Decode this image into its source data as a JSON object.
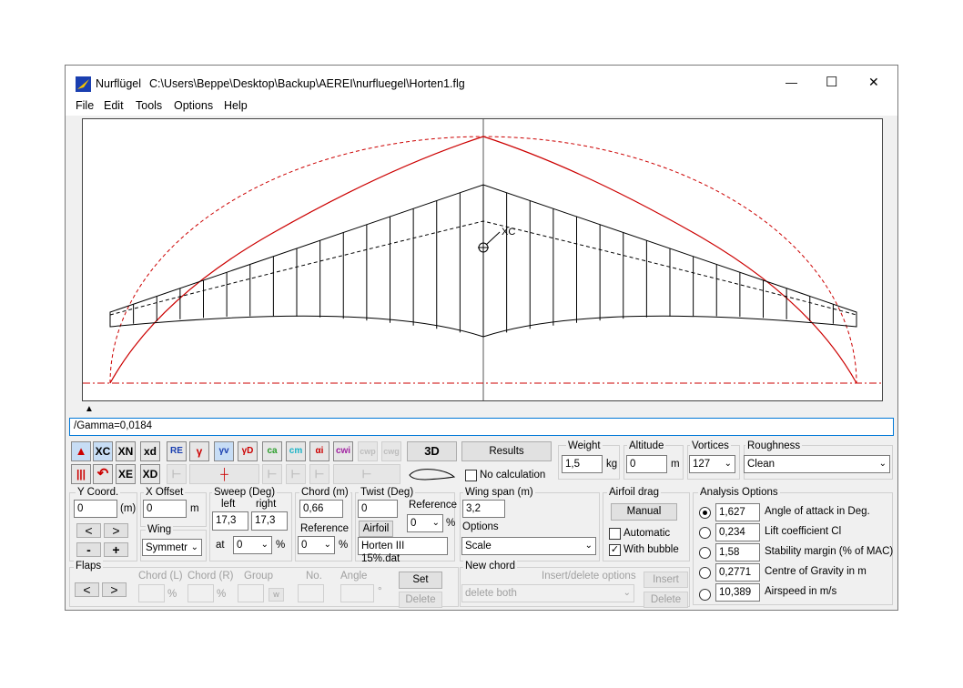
{
  "titlebar": {
    "app_name": "Nurflügel",
    "file_path": "C:\\Users\\Beppe\\Desktop\\Backup\\AEREI\\nurfluegel\\Horten1.flg",
    "minimize": "—",
    "maximize": "☐",
    "close": "✕"
  },
  "menu": [
    "File",
    "Edit",
    "Tools",
    "Options",
    "Help"
  ],
  "canvas": {
    "xc_label": "XC"
  },
  "status": "/Gamma=0,0184",
  "toolbar": {
    "row1": [
      "XC",
      "XN",
      "xd",
      "RE",
      "γ",
      "γv",
      "γD",
      "ca",
      "cm",
      "αi",
      "cwi",
      "cwp",
      "cwg"
    ],
    "row2": [
      "XE",
      "XD"
    ],
    "btn_3d": "3D"
  },
  "results": {
    "results_button": "Results",
    "no_calculation": "No calculation"
  },
  "weight": {
    "label": "Weight",
    "value": "1,5",
    "unit": "kg"
  },
  "altitude": {
    "label": "Altitude",
    "value": "0",
    "unit": "m"
  },
  "vortices": {
    "label": "Vortices",
    "value": "127"
  },
  "roughness": {
    "label": "Roughness",
    "value": "Clean"
  },
  "ycoord": {
    "label": "Y Coord.",
    "value": "0",
    "unit": "(m)"
  },
  "xoffset": {
    "label": "X Offset",
    "value": "0",
    "unit": "m"
  },
  "nav": {
    "left": "<",
    "right": ">",
    "minus": "-",
    "plus": "+"
  },
  "wing": {
    "label": "Wing",
    "value": "Symmetr"
  },
  "sweep": {
    "label": "Sweep (Deg)",
    "left_label": "left",
    "right_label": "right",
    "left": "17,3",
    "right": "17,3",
    "at_label": "at",
    "at_value": "0",
    "unit": "%"
  },
  "chord": {
    "label": "Chord (m)",
    "value": "0,66",
    "reference_label": "Reference",
    "reference": "0",
    "unit": "%"
  },
  "twist": {
    "label": "Twist (Deg)",
    "value": "0",
    "reference_label": "Reference",
    "reference": "0",
    "unit": "%",
    "airfoil_button": "Airfoil",
    "airfoil_name": "Horten III 15%.dat"
  },
  "wingspan": {
    "label": "Wing span (m)",
    "value": "3,2",
    "options_label": "Options",
    "options_value": "Scale"
  },
  "airfoil_drag": {
    "label": "Airfoil drag",
    "manual_button": "Manual",
    "automatic": "Automatic",
    "with_bubble": "With bubble"
  },
  "analysis": {
    "label": "Analysis Options",
    "rows": [
      {
        "value": "1,627",
        "label": "Angle of attack in Deg."
      },
      {
        "value": "0,234",
        "label": "Lift coefficient Cl"
      },
      {
        "value": "1,58",
        "label": "Stability margin (% of MAC)"
      },
      {
        "value": "0,2771",
        "label": "Centre of Gravity in m"
      },
      {
        "value": "10,389",
        "label": "Airspeed in m/s"
      }
    ]
  },
  "flaps": {
    "label": "Flaps",
    "left": "<",
    "right": ">",
    "chord_l": "Chord (L)",
    "chord_r": "Chord (R)",
    "group": "Group",
    "no": "No.",
    "angle": "Angle",
    "pct": "%",
    "w": "w",
    "deg": "°",
    "set_button": "Set",
    "delete_button": "Delete"
  },
  "new_chord": {
    "label": "New chord",
    "insert_options_label": "Insert/delete options",
    "value": "delete both",
    "insert_button": "Insert",
    "delete_button": "Delete"
  }
}
